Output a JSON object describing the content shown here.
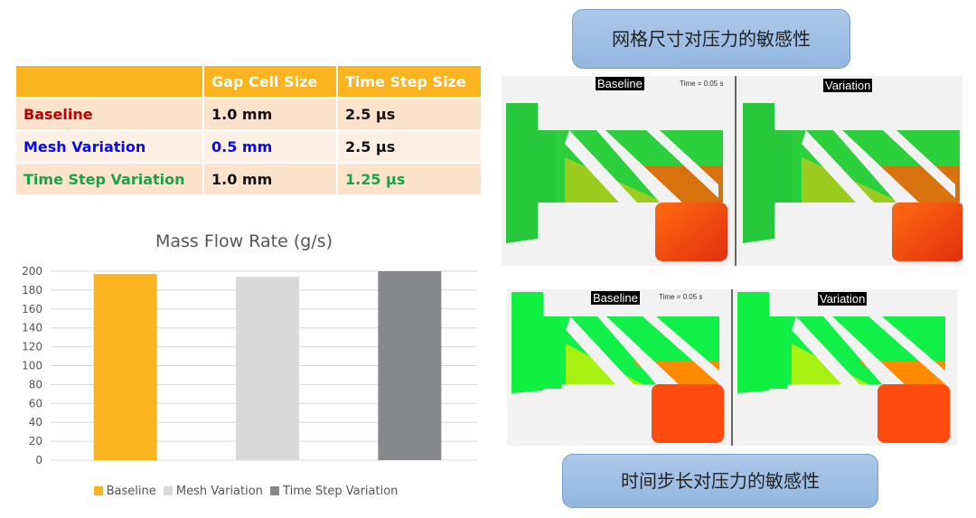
{
  "table": {
    "headers": [
      "",
      "Gap Cell Size",
      "Time Step Size"
    ],
    "rows": [
      {
        "name": "Baseline",
        "gap": "1.0 mm",
        "step": "2.5 µs",
        "name_color": "#c00000",
        "gap_color": "#111111",
        "step_color": "#111111"
      },
      {
        "name": "Mesh Variation",
        "gap": "0.5 mm",
        "step": "2.5 µs",
        "name_color": "#0a0aee",
        "gap_color": "#0a0aee",
        "step_color": "#111111"
      },
      {
        "name": "Time Step Variation",
        "gap": "1.0 mm",
        "step": "1.25 µs",
        "name_color": "#1aa34a",
        "gap_color": "#111111",
        "step_color": "#1aa34a"
      }
    ]
  },
  "chart_data": {
    "type": "bar",
    "title": "Mass Flow Rate (g/s)",
    "categories": [
      "Baseline",
      "Mesh Variation",
      "Time Step Variation"
    ],
    "values": [
      197,
      194,
      200
    ],
    "colors": [
      "#fbb41f",
      "#d9d9d9",
      "#87888b"
    ],
    "ylim": [
      0,
      200
    ],
    "yticks": [
      0,
      20,
      40,
      60,
      80,
      100,
      120,
      140,
      160,
      180,
      200
    ],
    "grid": true,
    "legend": "bottom",
    "xlabel": "",
    "ylabel": ""
  },
  "captions": {
    "mesh": "网格尺寸对压力的敏感性",
    "time": "时间步长对压力的敏感性"
  },
  "sims": {
    "baseline": "Baseline",
    "variation": "Variation",
    "time": "Time = 0.05 s"
  }
}
